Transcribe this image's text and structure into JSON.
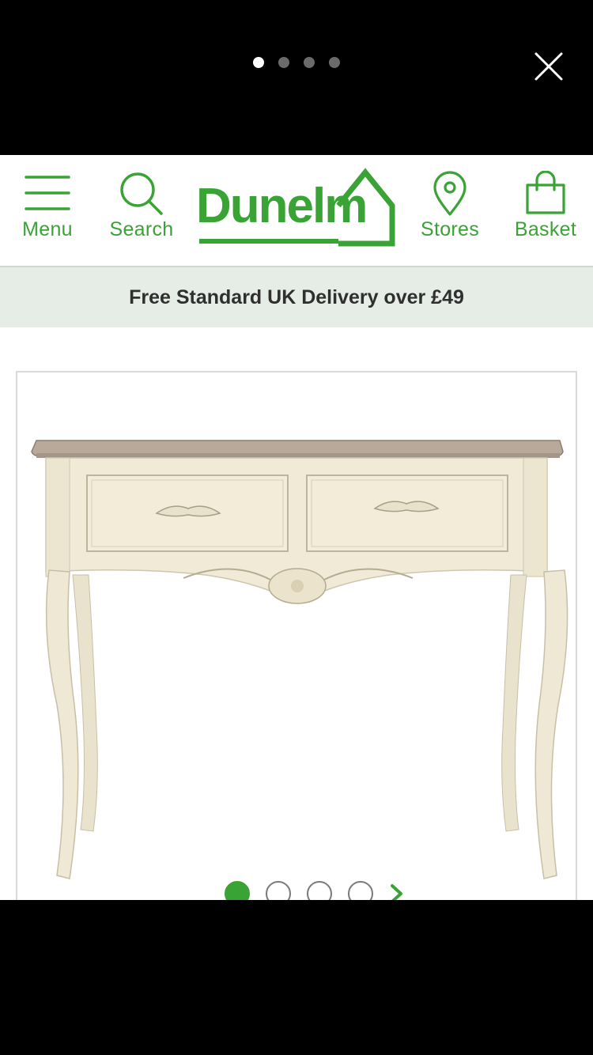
{
  "viewer": {
    "story_count": 4,
    "active_story": 0
  },
  "header": {
    "menu_label": "Menu",
    "search_label": "Search",
    "logo_text": "Dunelm",
    "stores_label": "Stores",
    "basket_label": "Basket"
  },
  "banner": {
    "text": "Free Standard UK Delivery over £49"
  },
  "product": {
    "image_count": 4,
    "active_image": 0
  },
  "colors": {
    "brand_green": "#3aa335",
    "banner_bg": "#e6ede6"
  },
  "icons": [
    "close-icon",
    "hamburger-icon",
    "search-icon",
    "location-pin-icon",
    "shopping-bag-icon",
    "chevron-right-icon"
  ]
}
